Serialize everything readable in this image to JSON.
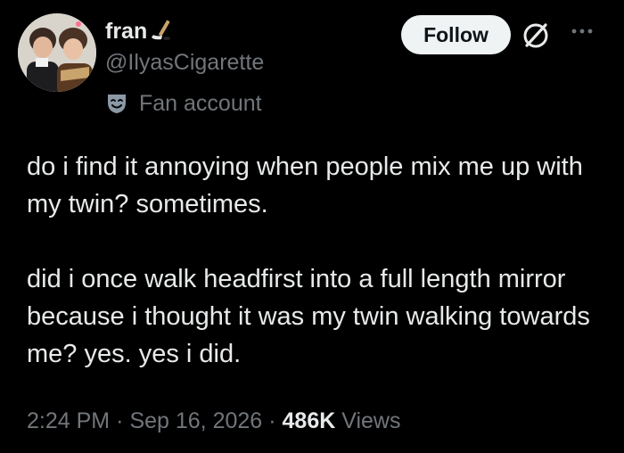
{
  "author": {
    "display_name": "fran",
    "handle": "@IlyasCigarette",
    "label": "Fan account"
  },
  "actions": {
    "follow_label": "Follow"
  },
  "icons": {
    "name_emoji": "hockey-stick-icon",
    "label_badge": "theater-masks-icon",
    "grok": "grok-icon",
    "more": "more-dots-icon"
  },
  "tweet": {
    "paragraphs": [
      "do i find it annoying when people mix me up with my twin? sometimes.",
      "did i once walk headfirst into a full length mirror because i thought it was my twin walking towards me? yes. yes i did."
    ],
    "time": "2:24 PM",
    "date": "Sep 16, 2026",
    "views_count": "486K",
    "views_label": "Views"
  },
  "colors": {
    "background": "#000000",
    "primary_text": "#e7e9ea",
    "secondary_text": "#71767b",
    "follow_bg": "#eff3f4",
    "follow_text": "#0f1419"
  }
}
